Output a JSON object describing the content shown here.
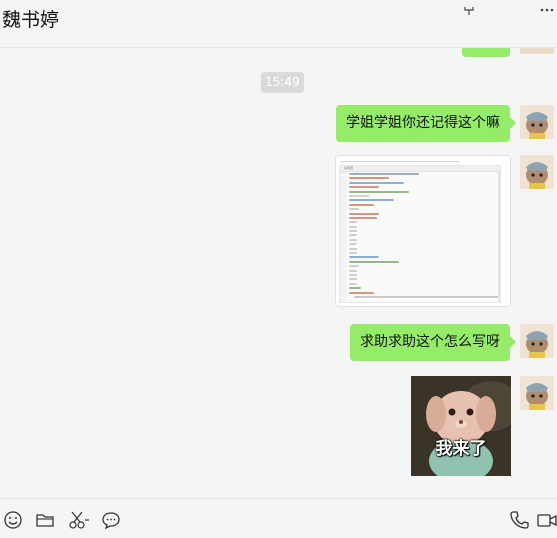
{
  "header": {
    "contact_name": "魏书婷",
    "icons": [
      "pin-icon",
      "more-icon"
    ]
  },
  "messages": [
    {
      "type": "time",
      "text": "15:49"
    },
    {
      "type": "text",
      "side": "right",
      "text": "学姐学姐你还记得这个嘛"
    },
    {
      "type": "image",
      "side": "right",
      "description_hidden": true,
      "editor_toolbar_caption": "编辑器",
      "code_line_colors": [
        "#7a8b99",
        "#c56b4a",
        "#5a8fbf",
        "#c56b4a",
        "#6c9c5a",
        "#bbbbbb",
        "#5a8fbf",
        "#c56b4a",
        "#bbbbbb",
        "#c56b4a",
        "#c56b4a",
        "#bbbbbb",
        "#bbbbbb",
        "#bbbbbb",
        "#bbbbbb",
        "#bbbbbb",
        "#bbbbbb",
        "#bbbbbb",
        "#bbbbbb",
        "#5a8fbf",
        "#6c9c5a",
        "#bbbbbb",
        "#bbbbbb",
        "#bbbbbb",
        "#bbbbbb",
        "#bbbbbb",
        "#6c9c5a",
        "#c56b4a"
      ]
    },
    {
      "type": "text",
      "side": "right",
      "text": "求助求助这个怎么写呀"
    },
    {
      "type": "sticker",
      "side": "right",
      "text": "我来了"
    }
  ],
  "toolbar": {
    "left_icons": [
      "emoji-icon",
      "folder-icon",
      "scissors-icon",
      "chat-history-icon"
    ],
    "right_icons": [
      "phone-icon",
      "video-call-icon"
    ]
  },
  "colors": {
    "bubble_green": "#95ec69",
    "background": "#f5f5f5",
    "time_pill": "#dadada"
  }
}
